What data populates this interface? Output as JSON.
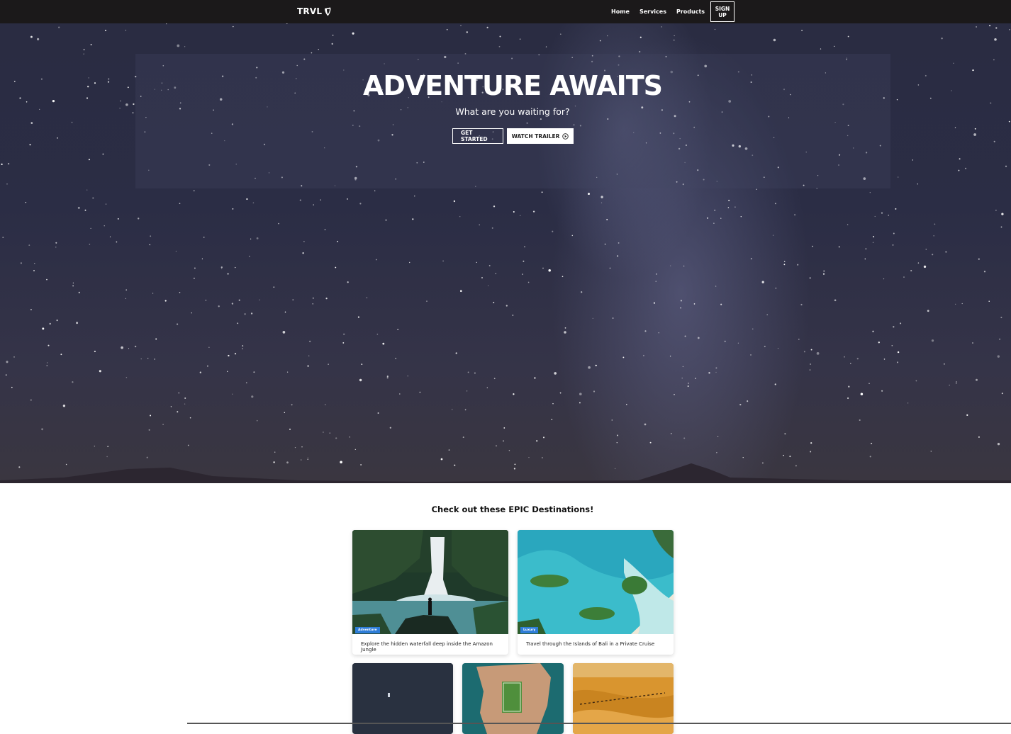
{
  "nav": {
    "logo_text": "TRVL",
    "links": [
      "Home",
      "Services",
      "Products"
    ],
    "signup_label": "SIGN\nUP"
  },
  "hero": {
    "title": "ADVENTURE AWAITS",
    "subtitle": "What are you waiting for?",
    "primary_button": "GET STARTED",
    "secondary_button": "WATCH TRAILER"
  },
  "destinations": {
    "title": "Check out these EPIC Destinations!",
    "cards": [
      {
        "tag": "Adventure",
        "caption": "Explore the hidden waterfall deep inside the Amazon Jungle"
      },
      {
        "tag": "Luxury",
        "caption": "Travel through the Islands of Bali in a Private Cruise"
      }
    ]
  },
  "icons": {
    "logo": "typo3-logo-icon",
    "play": "play-circle-icon"
  },
  "colors": {
    "navbar": "#1b191a",
    "tag": "#2e7dd8"
  }
}
